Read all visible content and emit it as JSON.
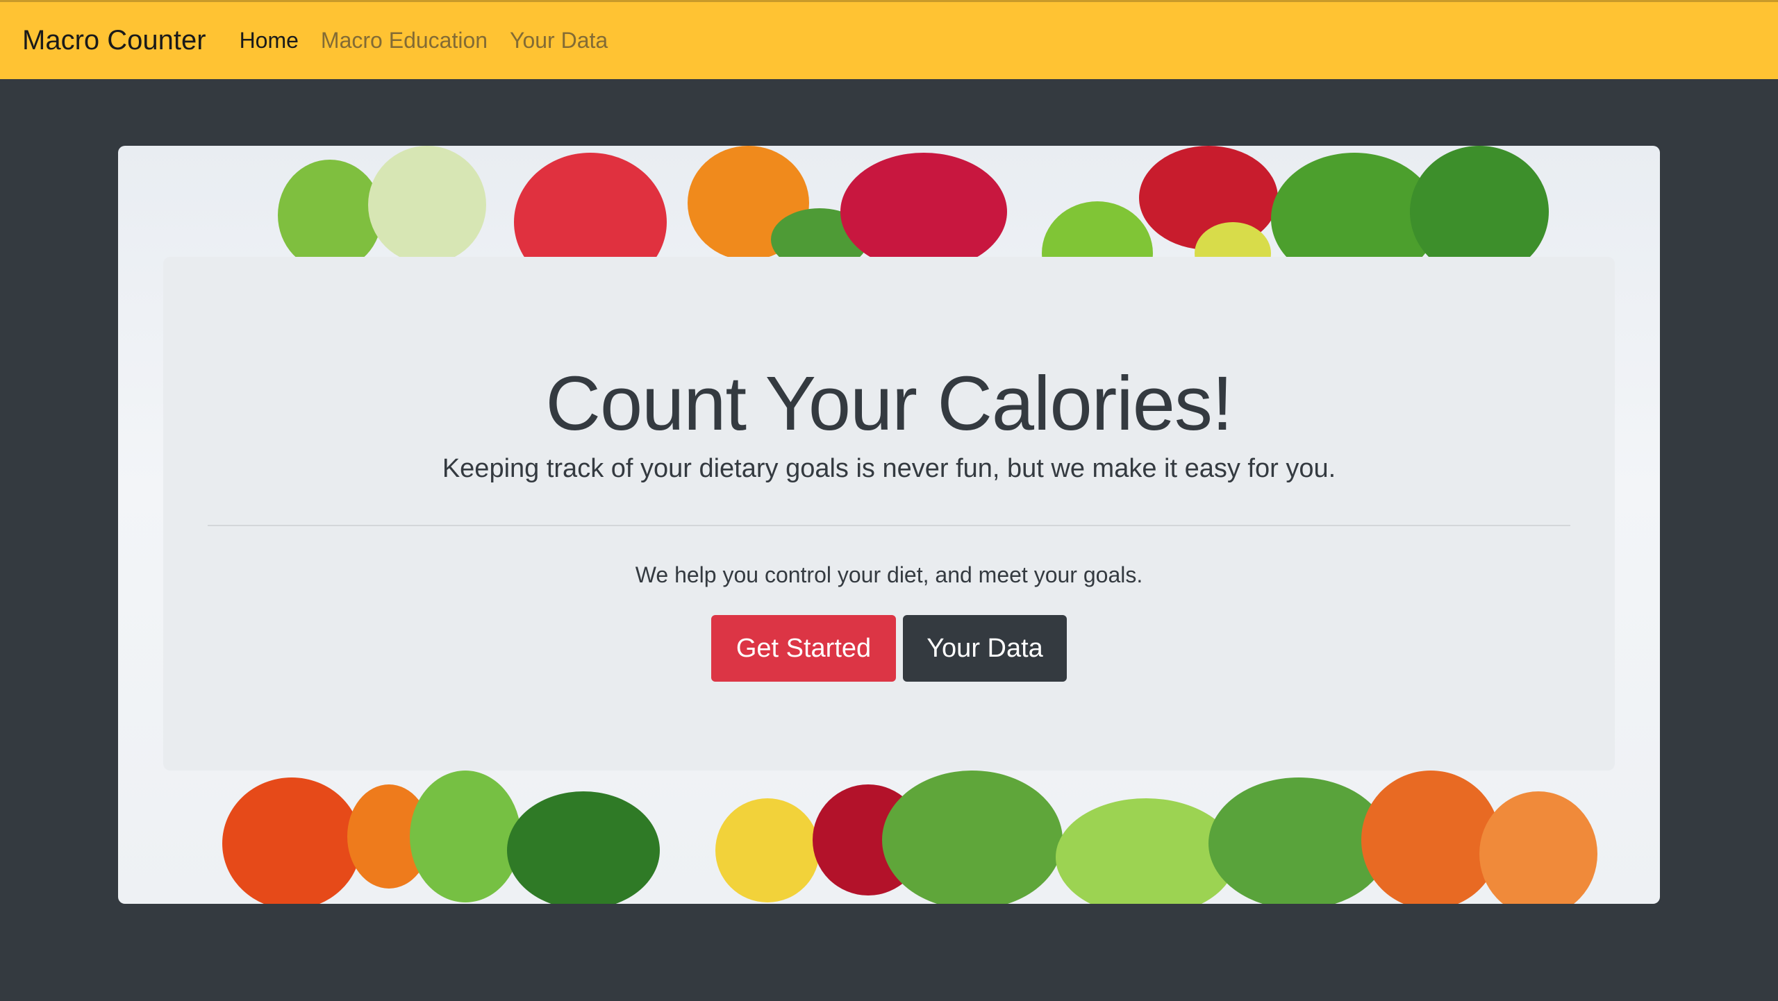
{
  "navbar": {
    "brand": "Macro Counter",
    "links": [
      {
        "label": "Home",
        "active": true
      },
      {
        "label": "Macro Education",
        "active": false
      },
      {
        "label": "Your Data",
        "active": false
      }
    ]
  },
  "hero": {
    "title": "Count Your Calories!",
    "lead": "Keeping track of your dietary goals is never fun, but we make it easy for you.",
    "subtext": "We help you control your diet, and meet your goals.",
    "buttons": {
      "get_started": "Get Started",
      "your_data": "Your Data"
    }
  },
  "colors": {
    "navbar_bg": "#ffc333",
    "page_bg": "#343a40",
    "card_bg": "#e9ecef",
    "primary_button": "#dc3545",
    "dark_button": "#343a40"
  },
  "background_image": "fruits-and-vegetables"
}
